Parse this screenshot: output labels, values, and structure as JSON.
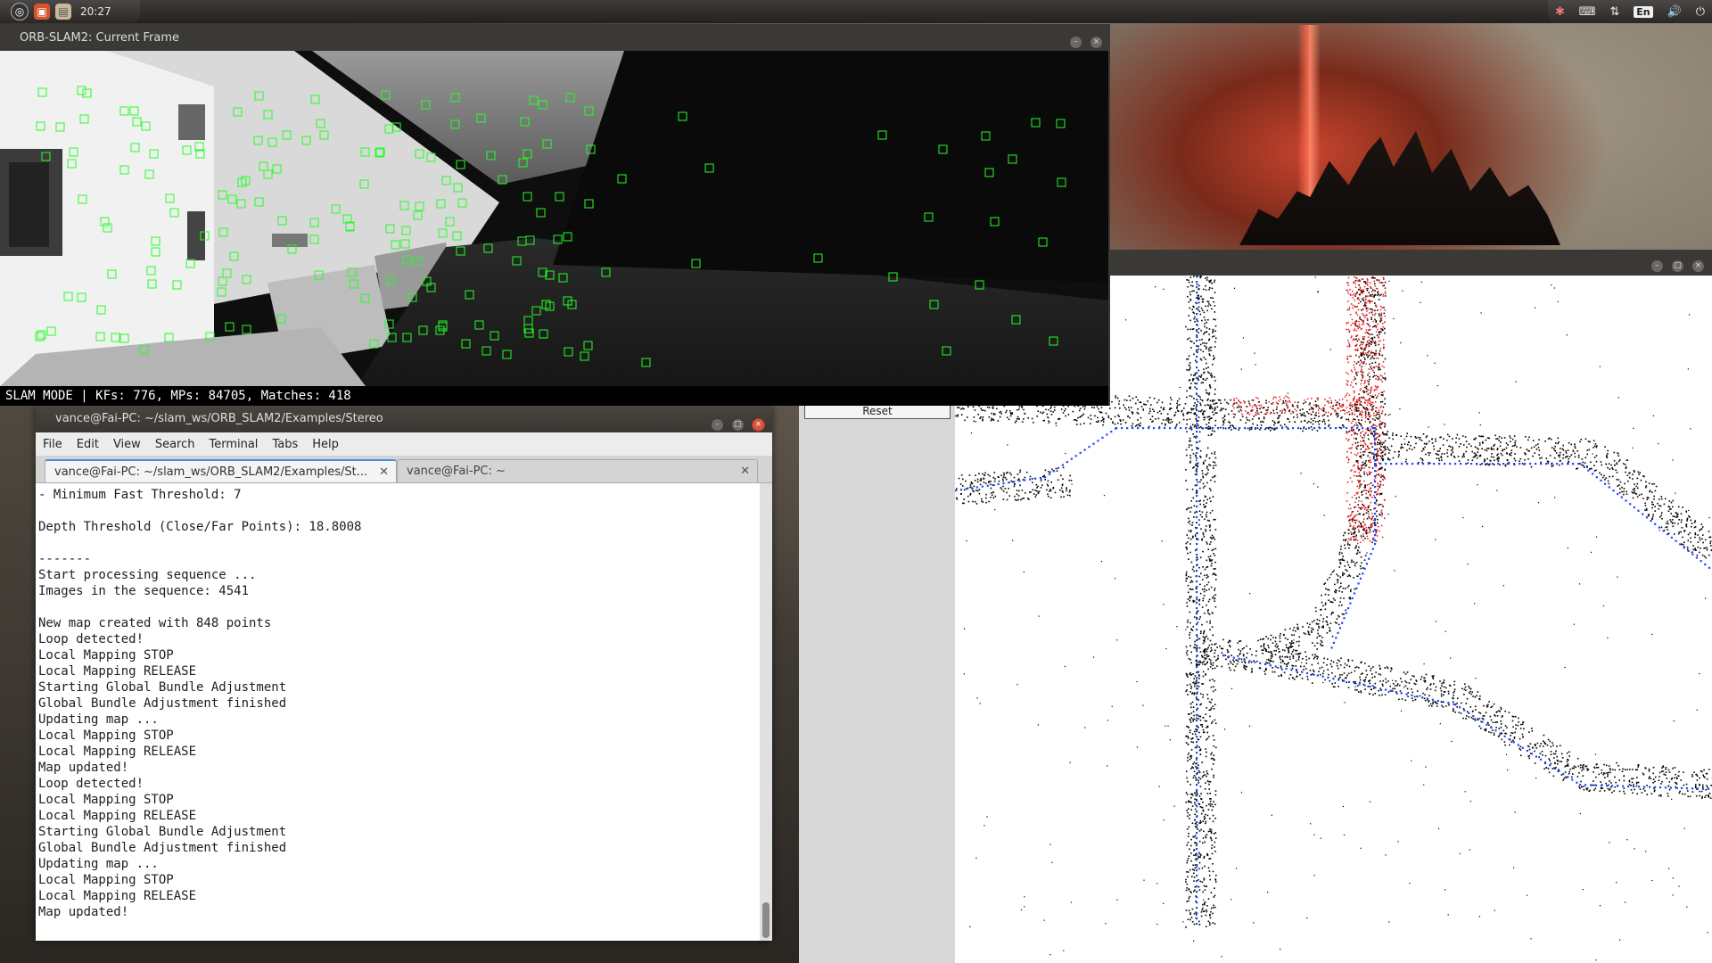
{
  "top_panel": {
    "clock": "20:27",
    "launcher_icons": [
      "ubuntu-logo-icon",
      "files-icon",
      "folder-icon"
    ],
    "tray_icons": [
      "settings-icon",
      "keyboard-icon",
      "network-icon",
      "volume-icon",
      "power-icon"
    ],
    "language": "En"
  },
  "orb_window": {
    "title": "ORB-SLAM2: Current Frame",
    "status": "SLAM MODE |  KFs: 776, MPs: 84705, Matches: 418"
  },
  "map_viewer": {
    "reset_label": "Reset"
  },
  "terminal": {
    "title": "vance@Fai-PC: ~/slam_ws/ORB_SLAM2/Examples/Stereo",
    "menu": [
      "File",
      "Edit",
      "View",
      "Search",
      "Terminal",
      "Tabs",
      "Help"
    ],
    "tabs": [
      {
        "label": "vance@Fai-PC: ~/slam_ws/ORB_SLAM2/Examples/St...",
        "close": "✕"
      },
      {
        "label": "vance@Fai-PC: ~",
        "close": "✕"
      }
    ],
    "lines": [
      "- Minimum Fast Threshold: 7",
      "",
      "Depth Threshold (Close/Far Points): 18.8008",
      "",
      "-------",
      "Start processing sequence ...",
      "Images in the sequence: 4541",
      "",
      "New map created with 848 points",
      "Loop detected!",
      "Local Mapping STOP",
      "Local Mapping RELEASE",
      "Starting Global Bundle Adjustment",
      "Global Bundle Adjustment finished",
      "Updating map ...",
      "Local Mapping STOP",
      "Local Mapping RELEASE",
      "Map updated!",
      "Loop detected!",
      "Local Mapping STOP",
      "Local Mapping RELEASE",
      "Starting Global Bundle Adjustment",
      "Global Bundle Adjustment finished",
      "Updating map ...",
      "Local Mapping STOP",
      "Local Mapping RELEASE",
      "Map updated!"
    ]
  },
  "colors": {
    "feature_box": "#22ff22",
    "trajectory": "#2244ff",
    "loop_points": "#ee1111",
    "map_points": "#000000"
  }
}
